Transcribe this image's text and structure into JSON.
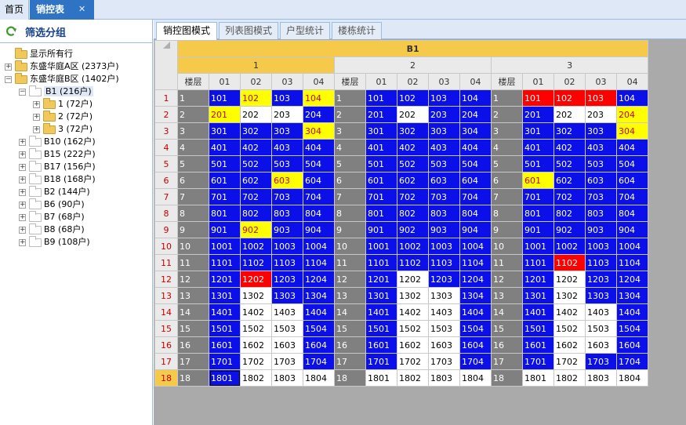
{
  "top_tabs": {
    "home": "首页",
    "sales": "销控表",
    "close": "✕"
  },
  "left": {
    "title": "筛选分组",
    "tree": [
      {
        "label": "显示所有行",
        "level": 0,
        "exp": "",
        "icon": "folder"
      },
      {
        "label": "东盛华庭A区 (2373户)",
        "level": 0,
        "exp": "+",
        "icon": "folder"
      },
      {
        "label": "东盛华庭B区 (1402户)",
        "level": 0,
        "exp": "-",
        "icon": "folder"
      },
      {
        "label": "B1 (216户)",
        "level": 1,
        "exp": "-",
        "icon": "plain",
        "selected": true
      },
      {
        "label": "1 (72户)",
        "level": 2,
        "exp": "+",
        "icon": "folder"
      },
      {
        "label": "2 (72户)",
        "level": 2,
        "exp": "+",
        "icon": "folder"
      },
      {
        "label": "3 (72户)",
        "level": 2,
        "exp": "+",
        "icon": "folder"
      },
      {
        "label": "B10 (162户)",
        "level": 1,
        "exp": "+",
        "icon": "plain"
      },
      {
        "label": "B15 (222户)",
        "level": 1,
        "exp": "+",
        "icon": "plain"
      },
      {
        "label": "B17 (156户)",
        "level": 1,
        "exp": "+",
        "icon": "plain"
      },
      {
        "label": "B18 (168户)",
        "level": 1,
        "exp": "+",
        "icon": "plain"
      },
      {
        "label": "B2 (144户)",
        "level": 1,
        "exp": "+",
        "icon": "plain"
      },
      {
        "label": "B6 (90户)",
        "level": 1,
        "exp": "+",
        "icon": "plain"
      },
      {
        "label": "B7 (68户)",
        "level": 1,
        "exp": "+",
        "icon": "plain"
      },
      {
        "label": "B8 (68户)",
        "level": 1,
        "exp": "+",
        "icon": "plain"
      },
      {
        "label": "B9 (108户)",
        "level": 1,
        "exp": "+",
        "icon": "plain"
      }
    ]
  },
  "sub_tabs": [
    "销控图模式",
    "列表图模式",
    "户型统计",
    "楼栋统计"
  ],
  "grid": {
    "building": "B1",
    "units": [
      "1",
      "2",
      "3"
    ],
    "floor_header": "楼层",
    "cols": [
      "01",
      "02",
      "03",
      "04"
    ],
    "rows": [
      {
        "n": "1",
        "u": [
          [
            "b",
            "y",
            "b",
            "y"
          ],
          [
            "b",
            "b",
            "b",
            "b"
          ],
          [
            "r",
            "r",
            "r",
            "b"
          ]
        ]
      },
      {
        "n": "2",
        "u": [
          [
            "y",
            "w",
            "w",
            "b"
          ],
          [
            "b",
            "w",
            "b",
            "b"
          ],
          [
            "b",
            "w",
            "w",
            "y"
          ]
        ]
      },
      {
        "n": "3",
        "u": [
          [
            "b",
            "b",
            "b",
            "y"
          ],
          [
            "b",
            "b",
            "b",
            "b"
          ],
          [
            "b",
            "b",
            "b",
            "y"
          ]
        ]
      },
      {
        "n": "4",
        "u": [
          [
            "b",
            "b",
            "b",
            "b"
          ],
          [
            "b",
            "b",
            "b",
            "b"
          ],
          [
            "b",
            "b",
            "b",
            "b"
          ]
        ]
      },
      {
        "n": "5",
        "u": [
          [
            "b",
            "b",
            "b",
            "b"
          ],
          [
            "b",
            "b",
            "b",
            "b"
          ],
          [
            "b",
            "b",
            "b",
            "b"
          ]
        ]
      },
      {
        "n": "6",
        "u": [
          [
            "b",
            "b",
            "y",
            "b"
          ],
          [
            "b",
            "b",
            "b",
            "b"
          ],
          [
            "y",
            "b",
            "b",
            "b"
          ]
        ]
      },
      {
        "n": "7",
        "u": [
          [
            "b",
            "b",
            "b",
            "b"
          ],
          [
            "b",
            "b",
            "b",
            "b"
          ],
          [
            "b",
            "b",
            "b",
            "b"
          ]
        ]
      },
      {
        "n": "8",
        "u": [
          [
            "b",
            "b",
            "b",
            "b"
          ],
          [
            "b",
            "b",
            "b",
            "b"
          ],
          [
            "b",
            "b",
            "b",
            "b"
          ]
        ]
      },
      {
        "n": "9",
        "u": [
          [
            "b",
            "y",
            "b",
            "b"
          ],
          [
            "b",
            "b",
            "b",
            "b"
          ],
          [
            "b",
            "b",
            "b",
            "b"
          ]
        ]
      },
      {
        "n": "10",
        "u": [
          [
            "b",
            "b",
            "b",
            "b"
          ],
          [
            "b",
            "b",
            "b",
            "b"
          ],
          [
            "b",
            "b",
            "b",
            "b"
          ]
        ]
      },
      {
        "n": "11",
        "u": [
          [
            "b",
            "b",
            "b",
            "b"
          ],
          [
            "b",
            "b",
            "b",
            "b"
          ],
          [
            "b",
            "r",
            "b",
            "b"
          ]
        ]
      },
      {
        "n": "12",
        "u": [
          [
            "b",
            "r",
            "b",
            "b"
          ],
          [
            "b",
            "w",
            "b",
            "b"
          ],
          [
            "b",
            "w",
            "b",
            "b"
          ]
        ]
      },
      {
        "n": "13",
        "u": [
          [
            "b",
            "w",
            "b",
            "b"
          ],
          [
            "b",
            "w",
            "w",
            "b"
          ],
          [
            "b",
            "w",
            "b",
            "b"
          ]
        ]
      },
      {
        "n": "14",
        "u": [
          [
            "b",
            "w",
            "w",
            "b"
          ],
          [
            "b",
            "w",
            "w",
            "b"
          ],
          [
            "b",
            "w",
            "w",
            "b"
          ]
        ]
      },
      {
        "n": "15",
        "u": [
          [
            "b",
            "w",
            "w",
            "b"
          ],
          [
            "b",
            "w",
            "w",
            "b"
          ],
          [
            "b",
            "w",
            "w",
            "b"
          ]
        ]
      },
      {
        "n": "16",
        "u": [
          [
            "b",
            "w",
            "w",
            "b"
          ],
          [
            "b",
            "w",
            "w",
            "b"
          ],
          [
            "b",
            "w",
            "w",
            "b"
          ]
        ]
      },
      {
        "n": "17",
        "u": [
          [
            "b",
            "w",
            "w",
            "b"
          ],
          [
            "b",
            "w",
            "w",
            "b"
          ],
          [
            "b",
            "w",
            "b",
            "b"
          ]
        ]
      },
      {
        "n": "18",
        "u": [
          [
            "b",
            "w",
            "w",
            "w"
          ],
          [
            "w",
            "w",
            "w",
            "w"
          ],
          [
            "w",
            "w",
            "w",
            "w"
          ]
        ]
      }
    ],
    "colors": {
      "blue": "#0b0fe8",
      "yellow": "#ffff00",
      "red": "#ff0000",
      "white": "#ffffff",
      "floor": "#808080",
      "header": "#f5c94a"
    }
  }
}
